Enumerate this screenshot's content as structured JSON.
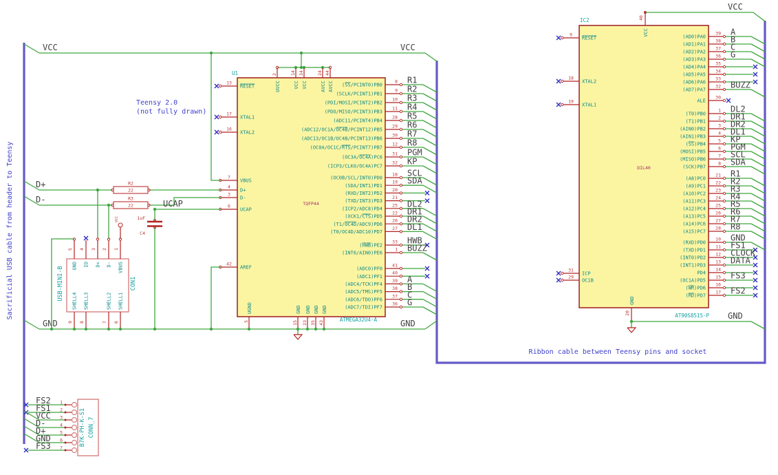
{
  "notes": {
    "usb_cable": "Sacrificial USB cable from header to Teensy",
    "teensy_line1": "Teensy 2.0",
    "teensy_line2": "(not fully drawn)",
    "ribbon": "Ribbon cable between Teensy pins and socket"
  },
  "labels": {
    "vcc": "VCC",
    "gnd": "GND",
    "ucap": "UCAP",
    "dplus": "D+",
    "dminus": "D-"
  },
  "colors": {
    "wire": "#3fa63f",
    "bus": "#6459c8",
    "body_fill": "#fbf5a2",
    "outline": "#a52a2a",
    "note_blue": "#4040cc",
    "pin_teal": "#0e8888",
    "num_red": "#c03030"
  },
  "u1": {
    "ref": "U1",
    "value": "ATMEGA32U4-A",
    "footprint": "TQFP44",
    "left_pins": [
      {
        "num": "13",
        "name": "~RESET~",
        "nc": true
      },
      {
        "num": "17",
        "name": "XTAL1",
        "nc": true
      },
      {
        "num": "16",
        "name": "XTAL2",
        "nc": true
      },
      {
        "num": "7",
        "name": "VBUS",
        "nc": false
      },
      {
        "num": "4",
        "name": "D+",
        "nc": false
      },
      {
        "num": "3",
        "name": "D-",
        "nc": false
      },
      {
        "num": "6",
        "name": "UCAP",
        "nc": false
      },
      {
        "num": "42",
        "name": "AREF",
        "nc": false
      }
    ],
    "top_pins": [
      {
        "num": "2",
        "name": "UVCC"
      },
      {
        "num": "14",
        "name": "VCC"
      },
      {
        "num": "34",
        "name": "VCC"
      },
      {
        "num": "24",
        "name": "AVCC"
      },
      {
        "num": "44",
        "name": "AVCC"
      }
    ],
    "bottom_pins": [
      {
        "num": "5",
        "name": "UGND"
      },
      {
        "num": "15",
        "name": "GND"
      },
      {
        "num": "23",
        "name": "GND"
      },
      {
        "num": "35",
        "name": "GND"
      },
      {
        "num": "43",
        "name": "GND"
      }
    ],
    "right_groups": [
      {
        "pins": [
          {
            "num": "8",
            "name": "(~SS~/PCINT0)PB0",
            "label": "R1",
            "term": "bus"
          },
          {
            "num": "9",
            "name": "(SCLK/PCINT1)PB1",
            "label": "R2",
            "term": "bus"
          },
          {
            "num": "10",
            "name": "(PDI/MOSI/PCINT2)PB2",
            "label": "R3",
            "term": "bus"
          },
          {
            "num": "11",
            "name": "(PDO/MISO/PCINT3)PB3",
            "label": "R4",
            "term": "bus"
          },
          {
            "num": "28",
            "name": "(ADC11/PCINT4)PB4",
            "label": "R5",
            "term": "bus"
          },
          {
            "num": "29",
            "name": "(ADC12/OC1A/~OC4B~/PCINT12)PB5",
            "label": "R6",
            "term": "bus"
          },
          {
            "num": "30",
            "name": "(ADC13/OC1B/OC4B/PCINT13)PB6",
            "label": "R7",
            "term": "bus"
          },
          {
            "num": "12",
            "name": "(OC0A/OC1C/~RTS~/PCINT7)PB7",
            "label": "R8",
            "term": "bus"
          }
        ]
      },
      {
        "pins": [
          {
            "num": "31",
            "name": "(OC3A/~OC4A~)PC6",
            "label": "PGM",
            "term": "bus"
          },
          {
            "num": "32",
            "name": "(ICP3/CLK0/OC4A)PC7",
            "label": "KP",
            "term": "bus"
          }
        ]
      },
      {
        "pins": [
          {
            "num": "18",
            "name": "(OC0B/SCL/INT0)PD0",
            "label": "SCL",
            "term": "bus"
          },
          {
            "num": "19",
            "name": "(SDA/INT1)PD1",
            "label": "SDA",
            "term": "bus"
          },
          {
            "num": "20",
            "name": "(RXD/INT2)PD2",
            "label": "",
            "term": "nc"
          },
          {
            "num": "21",
            "name": "(TXD/INT3)PD3",
            "label": "",
            "term": "nc"
          },
          {
            "num": "25",
            "name": "(ICP2/ADC8)PD4",
            "label": "DL2",
            "term": "bus"
          },
          {
            "num": "22",
            "name": "(XCK1/~CTS~)PD5",
            "label": "DR1",
            "term": "bus"
          },
          {
            "num": "26",
            "name": "(T1/~OC4D~/ADC9)PD6",
            "label": "DR2",
            "term": "bus"
          },
          {
            "num": "27",
            "name": "(T0/OC4D/ADC10)PD7",
            "label": "DL1",
            "term": "bus"
          }
        ]
      },
      {
        "pins": [
          {
            "num": "33",
            "name": "(~HWB~)PE2",
            "label": "HWB",
            "term": "nc"
          },
          {
            "num": "1",
            "name": "(INT6/AIN0)PE6",
            "label": "BUZZ",
            "term": "bus"
          }
        ]
      },
      {
        "pins": [
          {
            "num": "41",
            "name": "(ADC0)PF0",
            "label": "",
            "term": "nc"
          },
          {
            "num": "40",
            "name": "(ADC1)PF1",
            "label": "",
            "term": "nc"
          },
          {
            "num": "39",
            "name": "(ADC4/TCK)PF4",
            "label": "A",
            "term": "bus"
          },
          {
            "num": "38",
            "name": "(ADC5/TMS)PF5",
            "label": "B",
            "term": "bus"
          },
          {
            "num": "37",
            "name": "(ADC6/TDO)PF6",
            "label": "C",
            "term": "bus"
          },
          {
            "num": "36",
            "name": "(ADC7/TDI)PF7",
            "label": "G",
            "term": "bus"
          }
        ]
      }
    ]
  },
  "ic2": {
    "ref": "IC2",
    "value": "AT90S8515-P",
    "footprint": "DIL40",
    "left_pins": [
      {
        "num": "9",
        "name": "~RESET~",
        "nc": true
      },
      {
        "num": "18",
        "name": "XTAL2",
        "nc": true
      },
      {
        "num": "19",
        "name": "XTAL1",
        "nc": true
      },
      {
        "num": "31",
        "name": "ICP",
        "nc": true
      },
      {
        "num": "29",
        "name": "OC1B",
        "nc": true
      }
    ],
    "top_pin": {
      "num": "40",
      "name": "VCC"
    },
    "bottom_pin": {
      "num": "20",
      "name": "GND"
    },
    "right_groups": [
      {
        "pins": [
          {
            "num": "39",
            "name": "(AD0)PA0",
            "label": "A",
            "term": "bus"
          },
          {
            "num": "38",
            "name": "(AD1)PA1",
            "label": "B",
            "term": "bus"
          },
          {
            "num": "37",
            "name": "(AD2)PA2",
            "label": "C",
            "term": "bus"
          },
          {
            "num": "36",
            "name": "(AD3)PA3",
            "label": "G",
            "term": "bus"
          },
          {
            "num": "35",
            "name": "(AD4)PA4",
            "label": "",
            "term": "nc"
          },
          {
            "num": "34",
            "name": "(AD5)PA5",
            "label": "",
            "term": "nc"
          },
          {
            "num": "33",
            "name": "(AD6)PA6",
            "label": "",
            "term": "nc"
          },
          {
            "num": "32",
            "name": "(AD7)PA7",
            "label": "BUZZ",
            "term": "bus"
          }
        ]
      },
      {
        "pins": [
          {
            "num": "30",
            "name": "ALE",
            "label": "",
            "term": "ncshort"
          }
        ]
      },
      {
        "pins": [
          {
            "num": "1",
            "name": "(T0)PB0",
            "label": "DL2",
            "term": "bus"
          },
          {
            "num": "2",
            "name": "(T1)PB1",
            "label": "DR1",
            "term": "bus"
          },
          {
            "num": "3",
            "name": "(AIN0)PB2",
            "label": "DR2",
            "term": "bus"
          },
          {
            "num": "4",
            "name": "(AIN1)PB3",
            "label": "DL1",
            "term": "bus"
          },
          {
            "num": "5",
            "name": "(~SS~)PB4",
            "label": "KP",
            "term": "bus"
          },
          {
            "num": "6",
            "name": "(MOSI)PB5",
            "label": "PGM",
            "term": "bus"
          },
          {
            "num": "7",
            "name": "(MISO)PB6",
            "label": "SCL",
            "term": "bus"
          },
          {
            "num": "8",
            "name": "(SCK)PB7",
            "label": "SDA",
            "term": "bus"
          }
        ]
      },
      {
        "pins": [
          {
            "num": "21",
            "name": "(A8)PC0",
            "label": "R1",
            "term": "bus"
          },
          {
            "num": "22",
            "name": "(A9)PC1",
            "label": "R2",
            "term": "bus"
          },
          {
            "num": "23",
            "name": "(A10)PC2",
            "label": "R3",
            "term": "bus"
          },
          {
            "num": "24",
            "name": "(A11)PC3",
            "label": "R4",
            "term": "bus"
          },
          {
            "num": "25",
            "name": "(A12)PC4",
            "label": "R5",
            "term": "bus"
          },
          {
            "num": "26",
            "name": "(A13)PC5",
            "label": "R6",
            "term": "bus"
          },
          {
            "num": "27",
            "name": "(A14)PC6",
            "label": "R7",
            "term": "bus"
          },
          {
            "num": "28",
            "name": "(A15)PC7",
            "label": "R8",
            "term": "bus"
          }
        ]
      },
      {
        "pins": [
          {
            "num": "10",
            "name": "(RXD)PD0",
            "label": "GND",
            "term": "bus"
          },
          {
            "num": "11",
            "name": "(TXD)PD1",
            "label": "FS1",
            "term": "nc"
          },
          {
            "num": "12",
            "name": "(INT0)PD2",
            "label": "CLOCK",
            "term": "nc"
          },
          {
            "num": "13",
            "name": "(INT1)PD3",
            "label": "DATA",
            "term": "nc"
          },
          {
            "num": "14",
            "name": "PD4",
            "label": "",
            "term": "nc"
          },
          {
            "num": "15",
            "name": "(OC1A)PD5",
            "label": "FS3",
            "term": "nc"
          },
          {
            "num": "16",
            "name": "(~WR~)PD6",
            "label": "",
            "term": "nc"
          },
          {
            "num": "17",
            "name": "(~RD~)PD7",
            "label": "FS2",
            "term": "nc"
          }
        ]
      }
    ]
  },
  "con1": {
    "ref": "CON1",
    "value": "USB-MINI-B",
    "top_pins": [
      {
        "num": "5",
        "name": "GND"
      },
      {
        "num": "4",
        "name": "ID"
      },
      {
        "num": "3",
        "name": "D+"
      },
      {
        "num": "2",
        "name": "D-"
      },
      {
        "num": "1",
        "name": "VBUS"
      }
    ],
    "bottom_pins": [
      {
        "num": "9",
        "name": "SHELL4"
      },
      {
        "num": "8",
        "name": "SHELL3"
      },
      {
        "num": "7",
        "name": "SHELL2"
      },
      {
        "num": "6",
        "name": "SHELL1"
      }
    ],
    "vbus_power_label": "VCC"
  },
  "conn7": {
    "ref": "CONN_7",
    "value": "B7K-PH-K-S1",
    "pins": [
      {
        "num": "1",
        "label": "FS2",
        "nc": true
      },
      {
        "num": "2",
        "label": "FS1",
        "nc": true
      },
      {
        "num": "3",
        "label": "VCC",
        "nc": false
      },
      {
        "num": "4",
        "label": "D-",
        "nc": false
      },
      {
        "num": "5",
        "label": "D+",
        "nc": false
      },
      {
        "num": "6",
        "label": "GND",
        "nc": false
      },
      {
        "num": "7",
        "label": "FS3",
        "nc": true
      }
    ]
  },
  "r2": {
    "ref": "R2",
    "value": "22"
  },
  "r3": {
    "ref": "R3",
    "value": "22"
  },
  "c4": {
    "ref": "C4",
    "value": "1uF"
  }
}
